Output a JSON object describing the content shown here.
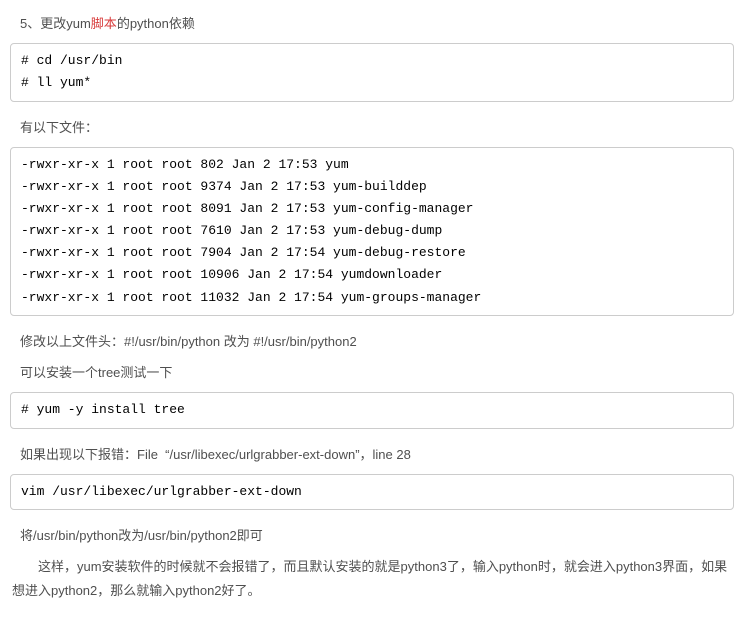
{
  "heading": {
    "prefix": "5、更改yum",
    "red": "脚本",
    "suffix": "的python依赖"
  },
  "code1": "# cd /usr/bin\n# ll yum*",
  "p1": "有以下文件：",
  "code2": "-rwxr-xr-x 1 root root 802 Jan 2 17:53 yum\n-rwxr-xr-x 1 root root 9374 Jan 2 17:53 yum-builddep\n-rwxr-xr-x 1 root root 8091 Jan 2 17:53 yum-config-manager\n-rwxr-xr-x 1 root root 7610 Jan 2 17:53 yum-debug-dump\n-rwxr-xr-x 1 root root 7904 Jan 2 17:54 yum-debug-restore\n-rwxr-xr-x 1 root root 10906 Jan 2 17:54 yumdownloader\n-rwxr-xr-x 1 root root 11032 Jan 2 17:54 yum-groups-manager",
  "p2": "修改以上文件头：#!/usr/bin/python 改为 #!/usr/bin/python2",
  "p3": "可以安装一个tree测试一下",
  "code3": "# yum -y install tree",
  "p4": "如果出现以下报错：File  “/usr/libexec/urlgrabber-ext-down”，line 28",
  "code4": "vim /usr/libexec/urlgrabber-ext-down",
  "p5": "将/usr/bin/python改为/usr/bin/python2即可",
  "p6": "这样，yum安装软件的时候就不会报错了，而且默认安装的就是python3了，输入python时，就会进入python3界面，如果想进入python2，那么就输入python2好了。"
}
